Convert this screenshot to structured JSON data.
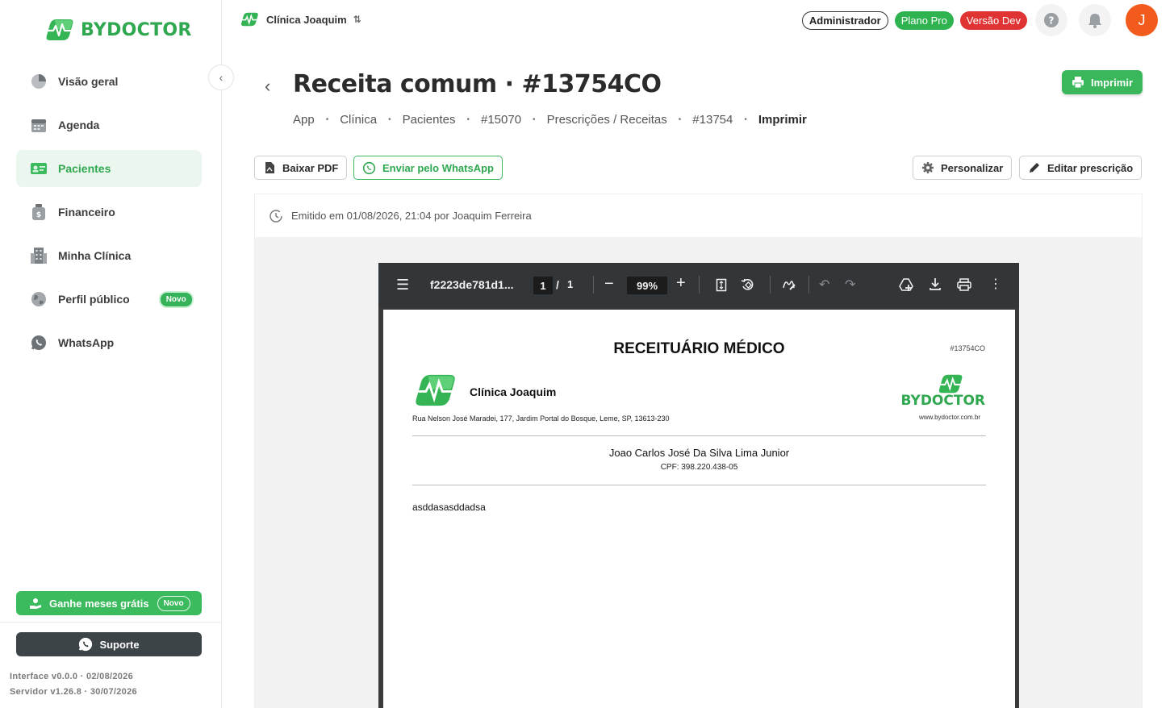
{
  "brand": {
    "name": "BYDOCTOR",
    "color": "#2fa84f"
  },
  "sidebar": {
    "items": [
      {
        "label": "Visão geral",
        "icon": "pie-chart-icon",
        "active": false
      },
      {
        "label": "Agenda",
        "icon": "calendar-icon",
        "active": false
      },
      {
        "label": "Pacientes",
        "icon": "id-card-icon",
        "active": true
      },
      {
        "label": "Financeiro",
        "icon": "money-bag-icon",
        "active": false
      },
      {
        "label": "Minha Clínica",
        "icon": "building-icon",
        "active": false
      },
      {
        "label": "Perfil público",
        "icon": "globe-icon",
        "active": false,
        "badge": "Novo"
      },
      {
        "label": "WhatsApp",
        "icon": "whatsapp-icon",
        "active": false
      }
    ],
    "promo": {
      "label": "Ganhe meses grátis",
      "badge": "Novo"
    },
    "support_label": "Suporte",
    "version_interface": "Interface v0.0.0 · 02/08/2026",
    "version_server": "Servidor v1.26.8 · 30/07/2026"
  },
  "topbar": {
    "clinic_name": "Clínica Joaquim",
    "role_badge": "Administrador",
    "plan_badge": "Plano Pro",
    "env_badge": "Versão Dev",
    "avatar_initial": "J"
  },
  "page": {
    "title": "Receita comum · #13754CO",
    "breadcrumb": [
      "App",
      "Clínica",
      "Pacientes",
      "#15070",
      "Prescrições / Receitas",
      "#13754",
      "Imprimir"
    ],
    "print_label": "Imprimir",
    "download_pdf_label": "Baixar PDF",
    "whatsapp_label": "Enviar pelo WhatsApp",
    "customize_label": "Personalizar",
    "edit_label": "Editar prescrição",
    "issued_text": "Emitido em 01/08/2026, 21:04 por Joaquim Ferreira"
  },
  "pdf_viewer": {
    "file_name": "f2223de781d1...",
    "current_page": "1",
    "page_separator": "/",
    "total_pages": "1",
    "zoom": "99%"
  },
  "document": {
    "title": "RECEITUÁRIO MÉDICO",
    "code": "#13754CO",
    "clinic_name": "Clínica Joaquim",
    "address": "Rua Nelson José Maradei, 177, Jardim Portal do Bosque, Leme, SP, 13613-230",
    "brand": "BYDOCTOR",
    "url": "www.bydoctor.com.br",
    "patient_name": "Joao Carlos José Da Silva Lima Junior",
    "patient_cpf": "CPF: 398.220.438-05",
    "body": "asddasasddadsa"
  }
}
